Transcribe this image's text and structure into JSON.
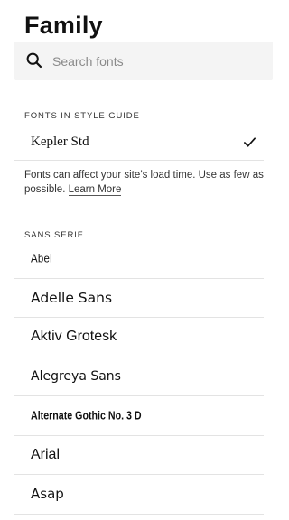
{
  "panel": {
    "title": "Family"
  },
  "search": {
    "placeholder": "Search fonts",
    "value": "",
    "icon": "search-icon"
  },
  "style_guide": {
    "label": "FONTS IN STYLE GUIDE",
    "selected_font": "Kepler Std",
    "selected_icon": "check-icon",
    "note_text": "Fonts can affect your site’s load time. Use as few as possible.",
    "learn_more": "Learn More"
  },
  "sans_serif": {
    "label": "SANS SERIF",
    "fonts": [
      "Abel",
      "Adelle Sans",
      "Aktiv Grotesk",
      "Alegreya Sans",
      "Alternate Gothic No. 3 D",
      "Arial",
      "Asap"
    ]
  }
}
